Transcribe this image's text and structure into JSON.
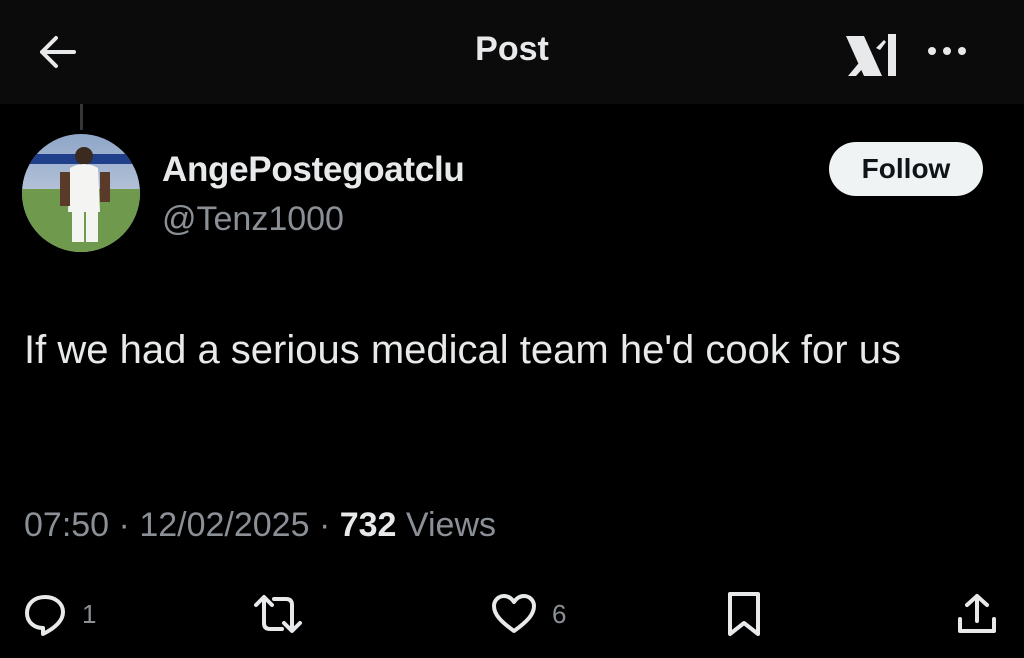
{
  "header": {
    "title": "Post",
    "back_icon": "arrow-left-icon",
    "logo_icon": "x-logo-icon",
    "more_icon": "more-horizontal-icon"
  },
  "author": {
    "display_name": "AngePostegoatclu",
    "handle": "@Tenz1000",
    "avatar_description": "football-player-photo"
  },
  "follow_button": {
    "label": "Follow"
  },
  "post": {
    "text": "If we had a serious medical team he'd cook for us",
    "time": "07:50",
    "date": "12/02/2025",
    "views_count": "732",
    "views_label": "Views"
  },
  "actions": {
    "reply": {
      "icon": "reply-icon",
      "count": "1"
    },
    "repost": {
      "icon": "repost-icon",
      "count": ""
    },
    "like": {
      "icon": "heart-icon",
      "count": "6"
    },
    "bookmark": {
      "icon": "bookmark-icon"
    },
    "share": {
      "icon": "share-icon"
    }
  },
  "colors": {
    "background": "#000000",
    "header_bg": "#0b0b0c",
    "primary_text": "#e7e9ea",
    "secondary_text": "#8b9096",
    "follow_bg": "#eff3f4"
  }
}
